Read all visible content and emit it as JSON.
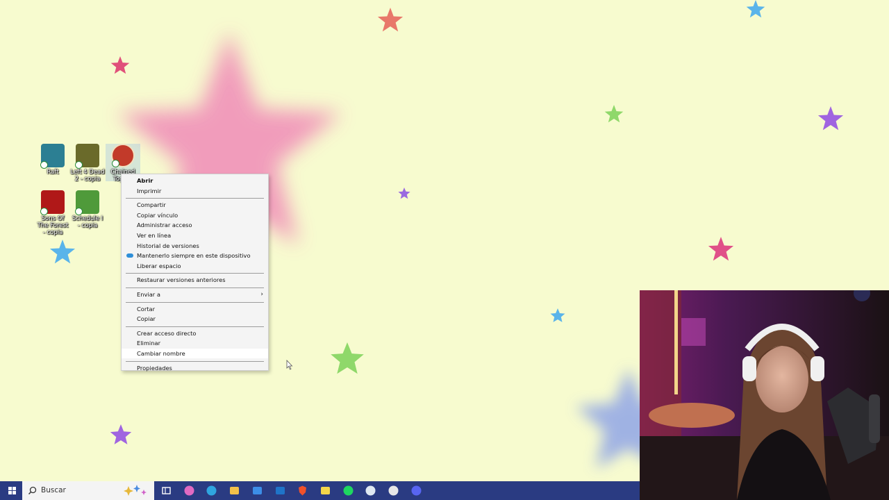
{
  "desktop": {
    "icons": [
      {
        "label": "Raft",
        "icon": "raft-game-icon",
        "color": "#2c7f93"
      },
      {
        "label": "Left 4 Dead 2 - copia",
        "icon": "left4dead2-game-icon",
        "color": "#6a6a2a"
      },
      {
        "label": "Chained Toge...",
        "icon": "chained-together-game-icon",
        "color": "#c23a2a"
      },
      {
        "label": "Sons Of The Forest - copia",
        "icon": "sons-of-the-forest-game-icon",
        "color": "#b01818"
      },
      {
        "label": "Schedule I - copia",
        "icon": "schedule-one-game-icon",
        "color": "#4f9a3a"
      }
    ]
  },
  "context_menu": {
    "groups": [
      [
        {
          "label": "Abrir",
          "bold": true
        },
        {
          "label": "Imprimir"
        }
      ],
      [
        {
          "label": "Compartir"
        },
        {
          "label": "Copiar vínculo"
        },
        {
          "label": "Administrar acceso"
        },
        {
          "label": "Ver en línea"
        },
        {
          "label": "Historial de versiones"
        },
        {
          "label": "Mantenerlo siempre en este dispositivo",
          "icon": "onedrive-cloud-icon"
        },
        {
          "label": "Liberar espacio"
        }
      ],
      [
        {
          "label": "Restaurar versiones anteriores"
        }
      ],
      [
        {
          "label": "Enviar a",
          "submenu": true
        }
      ],
      [
        {
          "label": "Cortar"
        },
        {
          "label": "Copiar"
        }
      ],
      [
        {
          "label": "Crear acceso directo"
        },
        {
          "label": "Eliminar"
        },
        {
          "label": "Cambiar nombre",
          "hover": true
        }
      ],
      [
        {
          "label": "Propiedades"
        }
      ]
    ]
  },
  "taskbar": {
    "search_placeholder": "Buscar",
    "pinned": [
      {
        "name": "task-view-icon",
        "color": "#ffffff"
      },
      {
        "name": "copilot-icon",
        "color": "#e06ac2"
      },
      {
        "name": "edge-icon",
        "color": "#2fa5e0"
      },
      {
        "name": "file-explorer-icon",
        "color": "#f2c04a"
      },
      {
        "name": "microsoft-store-icon",
        "color": "#3c8ee8"
      },
      {
        "name": "outlook-icon",
        "color": "#1f74c8"
      },
      {
        "name": "brave-icon",
        "color": "#f0512a"
      },
      {
        "name": "sticky-notes-icon",
        "color": "#f4d64a"
      },
      {
        "name": "spotify-icon",
        "color": "#1ed760"
      },
      {
        "name": "steam-icon",
        "color": "#dfe8f2"
      },
      {
        "name": "obs-icon",
        "color": "#e7e7e7"
      },
      {
        "name": "discord-icon",
        "color": "#5865f2"
      }
    ]
  },
  "colors": {
    "wallpaper": "#f7fbcf",
    "taskbar": "#2a3b82",
    "menu_bg": "#f4f4f4"
  }
}
